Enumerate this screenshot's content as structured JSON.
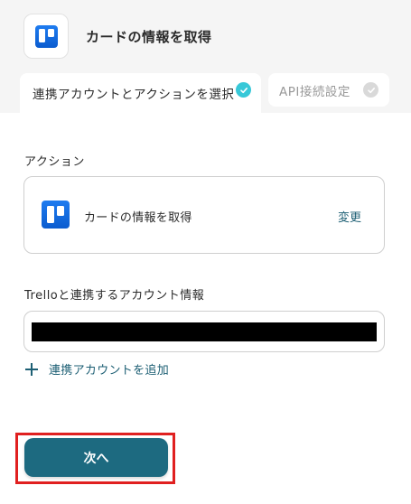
{
  "header": {
    "app_icon": "trello-logo",
    "title": "カードの情報を取得"
  },
  "tabs": [
    {
      "label": "連携アカウントとアクションを選択",
      "status": "complete",
      "check_color": "#37c8d8"
    },
    {
      "label": "API接続設定",
      "status": "incomplete",
      "check_color": "#d9d9d9"
    }
  ],
  "action_section": {
    "label": "アクション",
    "action_icon": "trello-logo",
    "action_name": "カードの情報を取得",
    "change_label": "変更"
  },
  "account_section": {
    "label": "Trelloと連携するアカウント情報",
    "value_redacted": true,
    "add_account_label": "連携アカウントを追加"
  },
  "footer": {
    "next_label": "次へ",
    "next_button_color": "#1d6a80",
    "highlight_color": "#e02020"
  }
}
